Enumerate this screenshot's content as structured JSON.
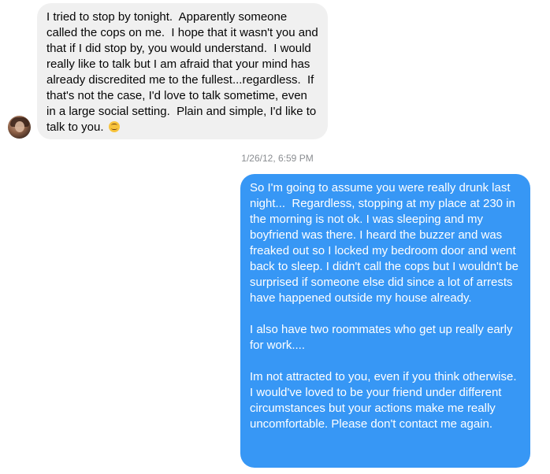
{
  "thread": {
    "incoming_message": {
      "text": "I tried to stop by tonight.  Apparently someone called the cops on me.  I hope that it wasn't you and that if I did stop by, you would understand.  I would really like to talk but I am afraid that your mind has already discredited me to the fullest...regardless.  If that's not the case, I'd love to talk sometime, even in a large social setting.  Plain and simple, I'd like to talk to you. ",
      "emoji": "smiling-face-icon"
    },
    "timestamp": "1/26/12, 6:59 PM",
    "outgoing_message": {
      "text": "So I'm going to assume you were really drunk last night...  Regardless, stopping at my place at 230 in the morning is not ok. I was sleeping and my boyfriend was there. I heard the buzzer and was freaked out so I locked my bedroom door and went back to sleep. I didn't call the cops but I wouldn't be surprised if someone else did since a lot of arrests have happened outside my house already.\n\nI also have two roommates who get up really early for work....\n\nIm not attracted to you, even if you think otherwise. I would've loved to be your friend under different circumstances but your actions make me really uncomfortable. Please don't contact me again."
    }
  },
  "colors": {
    "incoming_bubble": "#f0f0f0",
    "outgoing_bubble": "#3797f5",
    "timestamp_text": "#8a8d91"
  }
}
